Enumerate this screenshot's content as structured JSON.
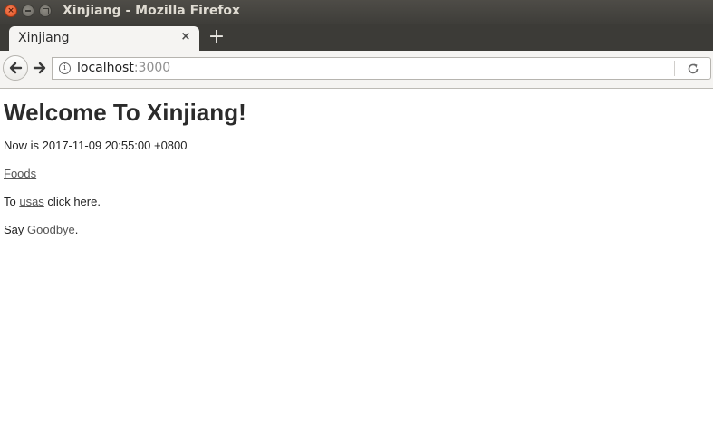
{
  "window": {
    "title": "Xinjiang - Mozilla Firefox"
  },
  "tabs": [
    {
      "label": "Xinjiang",
      "close_glyph": "×"
    }
  ],
  "new_tab_glyph": "+",
  "urlbar": {
    "host": "localhost",
    "port": ":3000"
  },
  "page": {
    "heading": "Welcome To Xinjiang!",
    "now_prefix": "Now is ",
    "now_value": "2017-11-09 20:55:00 +0800",
    "foods_link": "Foods",
    "usas_prefix": "To ",
    "usas_link": "usas",
    "usas_suffix": " click here.",
    "goodbye_prefix": "Say ",
    "goodbye_link": "Goodbye",
    "goodbye_suffix": "."
  },
  "icons": {
    "window_close": "close-icon",
    "window_minimize": "minimize-icon",
    "window_maximize": "maximize-icon",
    "back": "arrow-left-icon",
    "forward": "arrow-right-icon",
    "site_info": "info-icon",
    "reload": "reload-icon"
  },
  "colors": {
    "titlebar": "#3e3d39",
    "tab_active": "#f5f4f2",
    "close_button": "#e0511f",
    "link": "#555555"
  }
}
